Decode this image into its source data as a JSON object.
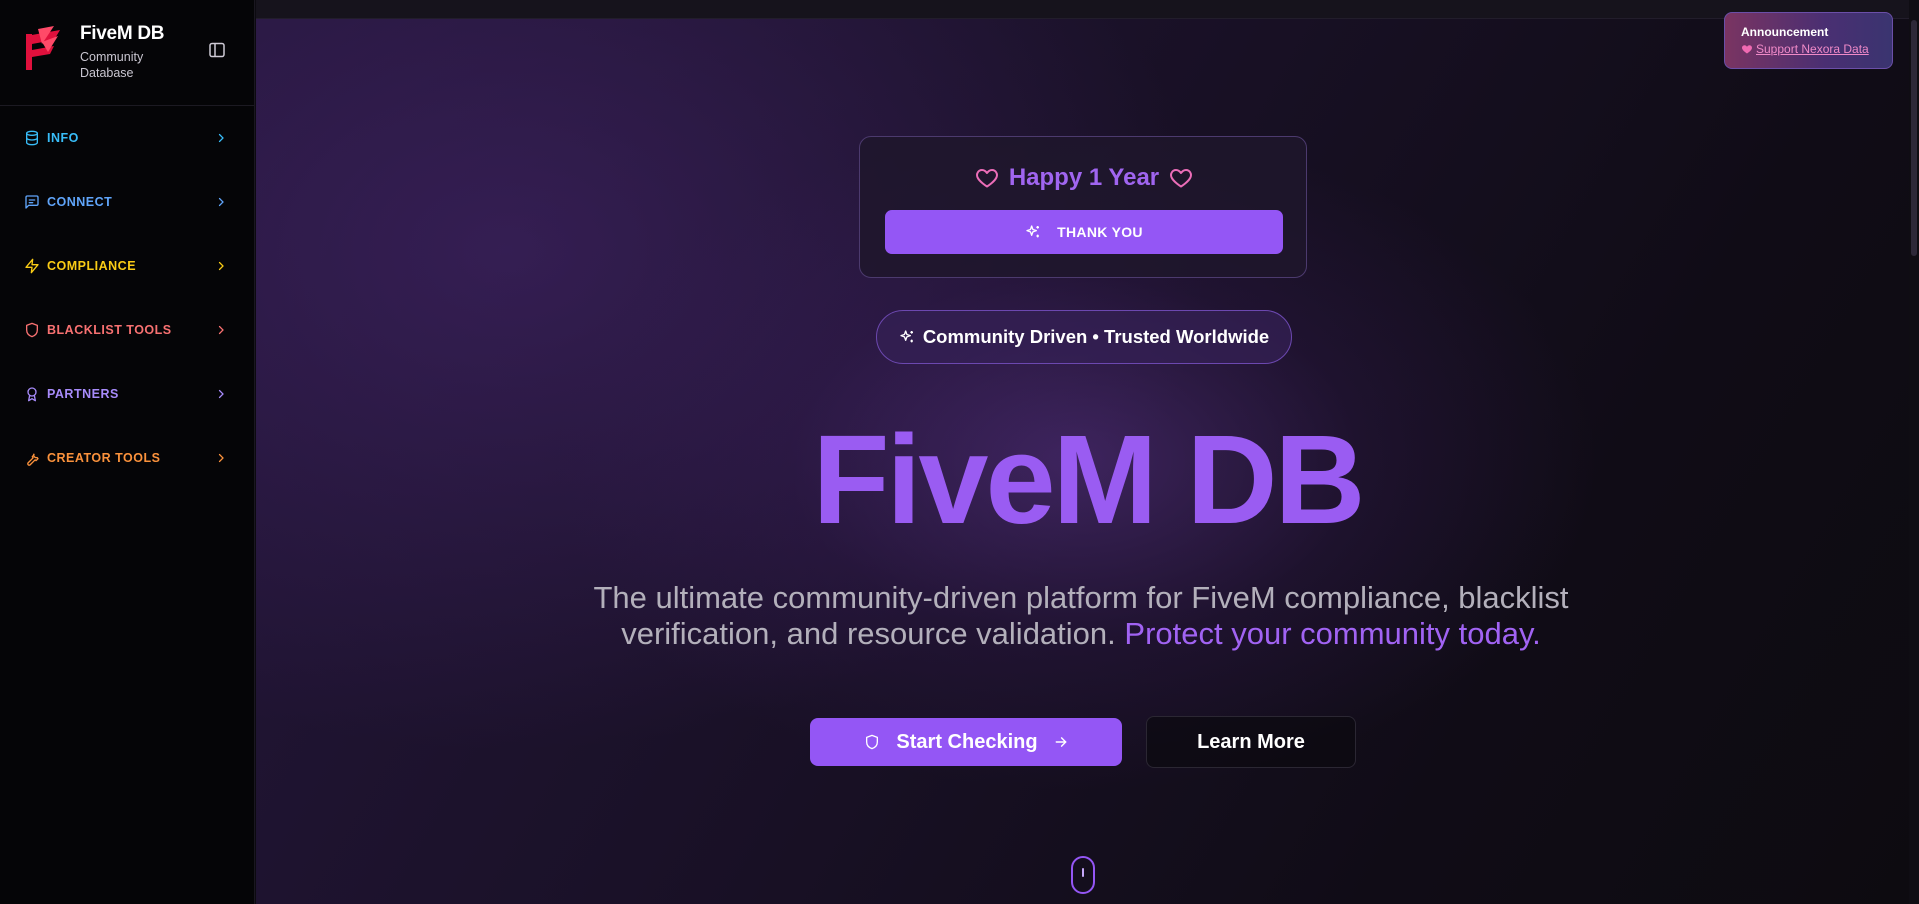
{
  "brand": {
    "title": "FiveM DB",
    "subtitle": "Community Database",
    "logo_icon": "fivem-f-logo-icon"
  },
  "sidebar": {
    "collapse_icon": "sidebar-toggle-icon",
    "items": [
      {
        "label": "INFO",
        "icon": "database-icon",
        "color": "#38bdf8"
      },
      {
        "label": "CONNECT",
        "icon": "message-square-icon",
        "color": "#60a5fa"
      },
      {
        "label": "COMPLIANCE",
        "icon": "zap-icon",
        "color": "#facc15"
      },
      {
        "label": "BLACKLIST TOOLS",
        "icon": "shield-icon",
        "color": "#f87171"
      },
      {
        "label": "PARTNERS",
        "icon": "award-icon",
        "color": "#a78bfa"
      },
      {
        "label": "CREATOR TOOLS",
        "icon": "wrench-icon",
        "color": "#fb923c"
      }
    ]
  },
  "announcement": {
    "title": "Announcement",
    "link_text": "Support Nexora Data",
    "icon": "heart-icon"
  },
  "anniversary": {
    "title": "Happy 1 Year",
    "button_label": "THANK YOU",
    "icon": "heart-icon",
    "button_icon": "sparkles-icon"
  },
  "badge": {
    "text": "Community Driven • Trusted Worldwide",
    "icon": "sparkles-icon"
  },
  "hero": {
    "title": "FiveM DB",
    "subtitle": "The ultimate community-driven platform for FiveM compliance, blacklist verification, and resource validation.",
    "subtitle_accent": "Protect your community today."
  },
  "actions": {
    "primary_label": "Start Checking",
    "secondary_label": "Learn More",
    "primary_icon": "shield-icon",
    "primary_trailing_icon": "arrow-right-icon"
  },
  "colors": {
    "accent": "#9456f5",
    "accent_text": "#9a5cf2",
    "background": "#0c0a10",
    "sidebar": "#050507"
  }
}
